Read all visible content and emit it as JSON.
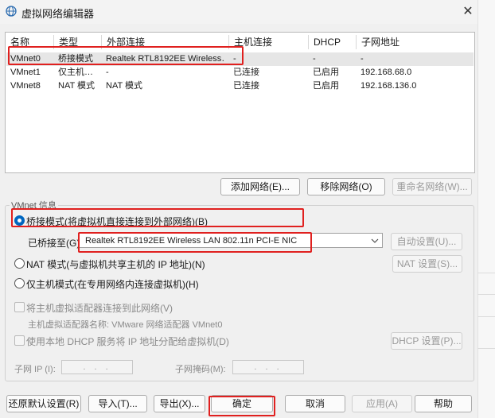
{
  "window": {
    "title": "虚拟网络编辑器",
    "close_glyph": "✕",
    "icon": "globe-icon"
  },
  "table": {
    "columns": [
      "名称",
      "类型",
      "外部连接",
      "主机连接",
      "DHCP",
      "子网地址"
    ],
    "rows": [
      {
        "name": "VMnet0",
        "type": "桥接模式",
        "external": "Realtek RTL8192EE Wireless…",
        "host": "-",
        "dhcp": "-",
        "subnet": "-"
      },
      {
        "name": "VMnet1",
        "type": "仅主机…",
        "external": "-",
        "host": "已连接",
        "dhcp": "已启用",
        "subnet": "192.168.68.0"
      },
      {
        "name": "VMnet8",
        "type": "NAT 模式",
        "external": "NAT 模式",
        "host": "已连接",
        "dhcp": "已启用",
        "subnet": "192.168.136.0"
      }
    ]
  },
  "table_buttons": {
    "add": "添加网络(E)...",
    "remove": "移除网络(O)",
    "rename": "重命名网络(W)..."
  },
  "vmnet_info": {
    "group_title": "VMnet 信息",
    "bridged_label": "桥接模式(将虚拟机直接连接到外部网络)(B)",
    "bridged_to_label": "已桥接至(G):",
    "bridged_adapter": "Realtek RTL8192EE Wireless LAN 802.11n PCI-E NIC",
    "auto_settings": "自动设置(U)...",
    "nat_label": "NAT 模式(与虚拟机共享主机的 IP 地址)(N)",
    "nat_settings": "NAT 设置(S)...",
    "hostonly_label": "仅主机模式(在专用网络内连接虚拟机)(H)",
    "connect_adapter_label": "将主机虚拟适配器连接到此网络(V)",
    "adapter_name_label": "主机虚拟适配器名称: VMware 网络适配器 VMnet0",
    "dhcp_label": "使用本地 DHCP 服务将 IP 地址分配给虚拟机(D)",
    "dhcp_settings": "DHCP 设置(P)...",
    "subnet_ip_label": "子网 IP (I):",
    "subnet_mask_label": "子网掩码(M):",
    "ip_placeholder": ". . .",
    "selected_mode": "bridged"
  },
  "footer": {
    "restore": "还原默认设置(R)",
    "import": "导入(T)...",
    "export": "导出(X)...",
    "ok": "确定",
    "cancel": "取消",
    "apply": "应用(A)",
    "help": "帮助"
  },
  "colors": {
    "highlight": "#e0201f",
    "accent": "#0067c0",
    "selected_row": "#e6e6e6"
  }
}
